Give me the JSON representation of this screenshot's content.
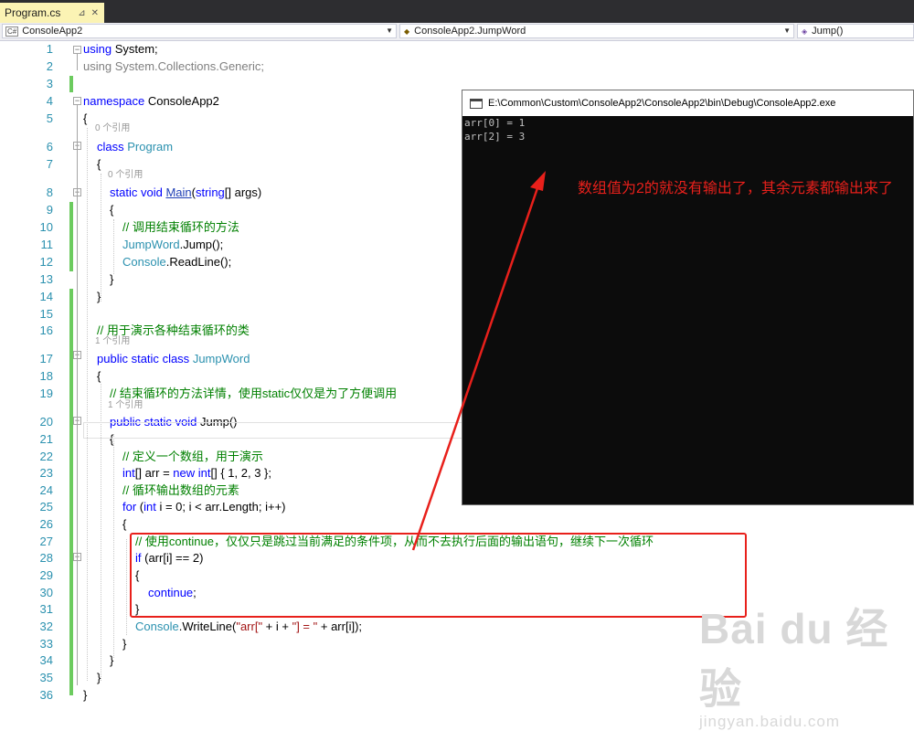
{
  "tab": {
    "title": "Program.cs",
    "pin_icon": "pin-icon",
    "close_icon": "close-icon"
  },
  "navbar": {
    "project": "ConsoleApp2",
    "type": "ConsoleApp2.JumpWord",
    "member": "Jump()"
  },
  "code_lines": [
    {
      "n": "1",
      "html": "<span class='kw'>using</span> System;"
    },
    {
      "n": "2",
      "html": "<span class='gr'>using System.Collections.Generic;</span>"
    },
    {
      "n": "3",
      "html": ""
    },
    {
      "n": "4",
      "html": "<span class='kw'>namespace</span> ConsoleApp2"
    },
    {
      "n": "5",
      "html": "{"
    },
    {
      "n": "6",
      "html": "<span class='kw'>class</span> <span class='ty'>Program</span>"
    },
    {
      "n": "7",
      "html": "{"
    },
    {
      "n": "8",
      "html": "<span class='kw'>static</span> <span class='kw'>void</span> <span class='mn'>Main</span>(<span class='kw'>string</span>[] args)"
    },
    {
      "n": "9",
      "html": "{"
    },
    {
      "n": "10",
      "html": "<span class='cm'>// 调用结束循环的方法</span>"
    },
    {
      "n": "11",
      "html": "<span class='ty'>JumpWord</span>.Jump();"
    },
    {
      "n": "12",
      "html": "<span class='ty'>Console</span>.ReadLine();"
    },
    {
      "n": "13",
      "html": "}"
    },
    {
      "n": "14",
      "html": "}"
    },
    {
      "n": "15",
      "html": ""
    },
    {
      "n": "16",
      "html": "<span class='cm'>// 用于演示各种结束循环的类</span>"
    },
    {
      "n": "17",
      "html": "<span class='kw'>public</span> <span class='kw'>static</span> <span class='kw'>class</span> <span class='ty'>JumpWord</span>"
    },
    {
      "n": "18",
      "html": "{"
    },
    {
      "n": "19",
      "html": "<span class='cm'>// 结束循环的方法详情，使用static仅仅是为了方便调用</span>"
    },
    {
      "n": "20",
      "html": "<span class='kw'>public</span> <span class='kw'>static</span> <span class='kw'>void</span> Jump()"
    },
    {
      "n": "21",
      "html": "{"
    },
    {
      "n": "22",
      "html": "<span class='cm'>// 定义一个数组，用于演示</span>"
    },
    {
      "n": "23",
      "html": "<span class='kw'>int</span>[] arr = <span class='kw'>new</span> <span class='kw'>int</span>[] { 1, 2, 3 };"
    },
    {
      "n": "24",
      "html": "<span class='cm'>// 循环输出数组的元素</span>"
    },
    {
      "n": "25",
      "html": "<span class='kw'>for</span> (<span class='kw'>int</span> i = 0; i &lt; arr.Length; i++)"
    },
    {
      "n": "26",
      "html": "{"
    },
    {
      "n": "27",
      "html": "<span class='cm'>// 使用continue，仅仅只是跳过当前满足的条件项，从而不去执行后面的输出语句，继续下一次循环</span>"
    },
    {
      "n": "28",
      "html": "<span class='kw'>if</span> (arr[i] == 2)"
    },
    {
      "n": "29",
      "html": "{"
    },
    {
      "n": "30",
      "html": "<span class='kw'>continue</span>;"
    },
    {
      "n": "31",
      "html": "}"
    },
    {
      "n": "32",
      "html": "<span class='ty'>Console</span>.WriteLine(<span class='st'>\"arr[\"</span> + i + <span class='st'>\"] = \"</span> + arr[i]);"
    },
    {
      "n": "33",
      "html": "}"
    },
    {
      "n": "34",
      "html": "}"
    },
    {
      "n": "35",
      "html": "}"
    },
    {
      "n": "36",
      "html": "}"
    }
  ],
  "code_lens": {
    "zero_refs": "0 个引用",
    "one_ref": "1 个引用"
  },
  "console": {
    "title": "E:\\Common\\Custom\\ConsoleApp2\\ConsoleApp2\\bin\\Debug\\ConsoleApp2.exe",
    "output": [
      "arr[0] = 1",
      "arr[2] = 3"
    ]
  },
  "annotation": "数组值为2的就没有输出了，其余元素都输出来了",
  "watermark": {
    "brand": "Bai du 经验",
    "url": "jingyan.baidu.com"
  },
  "colors": {
    "accent": "#007acc",
    "annotation_red": "#e8201b",
    "change_bar": "#6ccb5f"
  }
}
